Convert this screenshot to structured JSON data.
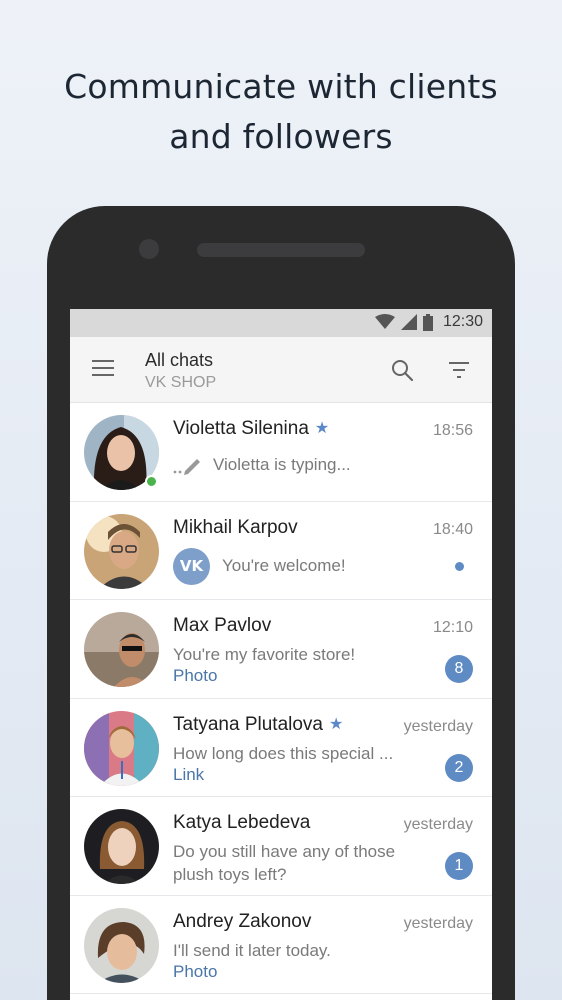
{
  "headline": {
    "line1": "Communicate with clients",
    "line2": "and followers"
  },
  "status_bar": {
    "time": "12:30",
    "icons": [
      "wifi-icon",
      "signal-icon",
      "battery-icon"
    ]
  },
  "app_bar": {
    "title": "All chats",
    "subtitle": "VK SHOP",
    "icons": [
      "menu-icon",
      "search-icon",
      "filter-icon"
    ]
  },
  "colors": {
    "accent": "#5e8bc4",
    "link": "#4a76a8",
    "online": "#4bb34b"
  },
  "chats": [
    {
      "name": "Violetta Silenina",
      "starred": true,
      "time": "18:56",
      "preview": "Violetta is typing...",
      "online": true
    },
    {
      "name": "Mikhail Karpov",
      "starred": false,
      "time": "18:40",
      "preview": "You're welcome!",
      "vk_badge": "VK",
      "unread_dot": true
    },
    {
      "name": "Max Pavlov",
      "starred": false,
      "time": "12:10",
      "preview": "You're my favorite store!",
      "attachment": "Photo",
      "unread": "8"
    },
    {
      "name": "Tatyana Plutalova",
      "starred": true,
      "time": "yesterday",
      "preview": "How long does this special ...",
      "attachment": "Link",
      "unread": "2"
    },
    {
      "name": "Katya Lebedeva",
      "starred": false,
      "time": "yesterday",
      "preview": "Do you still have any of those plush toys left?",
      "unread": "1"
    },
    {
      "name": "Andrey Zakonov",
      "starred": false,
      "time": "yesterday",
      "preview": "I'll send it later today.",
      "attachment": "Photo"
    }
  ]
}
